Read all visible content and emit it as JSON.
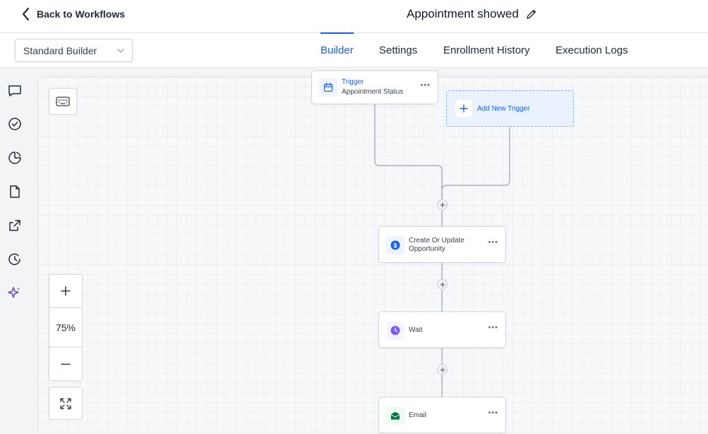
{
  "header": {
    "back_label": "Back to Workflows",
    "title": "Appointment showed"
  },
  "subbar": {
    "builder_select": "Standard Builder",
    "tabs": [
      {
        "label": "Builder",
        "active": true
      },
      {
        "label": "Settings",
        "active": false
      },
      {
        "label": "Enrollment History",
        "active": false
      },
      {
        "label": "Execution Logs",
        "active": false
      }
    ]
  },
  "rail": {
    "icons": [
      "chat-icon",
      "check-circle-icon",
      "pie-chart-icon",
      "document-icon",
      "external-link-icon",
      "history-icon",
      "sparkle-icon"
    ]
  },
  "zoom": {
    "level": "75%"
  },
  "workflow": {
    "trigger": {
      "label": "Trigger",
      "sub": "Appointment Status"
    },
    "add_trigger": "Add New Trigger",
    "steps": [
      {
        "line1": "Create Or Update",
        "line2": "Opportunity",
        "icon": "dollar-icon",
        "color": "#155eef"
      },
      {
        "line1": "Wait",
        "line2": "",
        "icon": "clock-icon",
        "color": "#7a5af8"
      },
      {
        "line1": "Email",
        "line2": "",
        "icon": "envelope-icon",
        "color": "#067647"
      }
    ]
  },
  "colors": {
    "accent": "#155eef",
    "wait": "#7a5af8",
    "email": "#067647",
    "sparkle": "#6941c6"
  }
}
